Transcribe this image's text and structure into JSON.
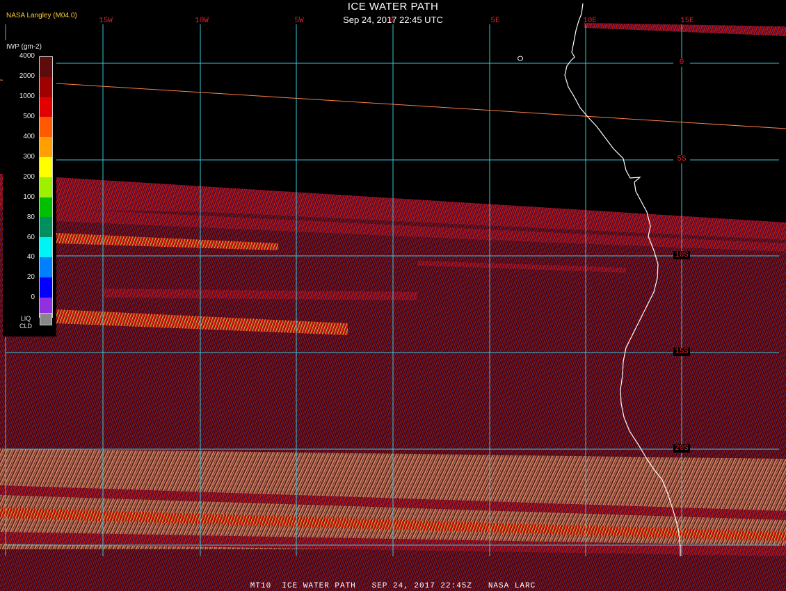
{
  "title": "ICE WATER PATH",
  "subtitle": "Sep 24, 2017 22:45 UTC",
  "credit": "NASA Langley (M04.0)",
  "footer": "MT10  ICE WATER PATH   SEP 24, 2017 22:45Z   NASA LARC",
  "longitude_labels": [
    "15W",
    "10W",
    "5W",
    "0",
    "5E",
    "10E",
    "15E"
  ],
  "latitude_labels": [
    "0",
    "5S",
    "10S",
    "15S",
    "20S"
  ],
  "legend": {
    "title": "IWP (gm-2)",
    "ticks": [
      "4000",
      "2000",
      "1000",
      "500",
      "400",
      "300",
      "200",
      "100",
      "80",
      "60",
      "40",
      "20",
      "0"
    ],
    "colors": [
      "#5e0b0b",
      "#a00000",
      "#e30000",
      "#ff5a00",
      "#ffa000",
      "#ffff00",
      "#9cf000",
      "#00c000",
      "#009060",
      "#00f4f4",
      "#0080ff",
      "#0000ff",
      "#9030e0"
    ],
    "liquid_label_1": "LIQ",
    "liquid_label_2": "CLD",
    "liquid_color": "#888888"
  },
  "colors": {
    "grid": "#36c8d8",
    "label": "#e0202a",
    "coast": "#ffffff",
    "satellite_track": "#ff8040"
  }
}
